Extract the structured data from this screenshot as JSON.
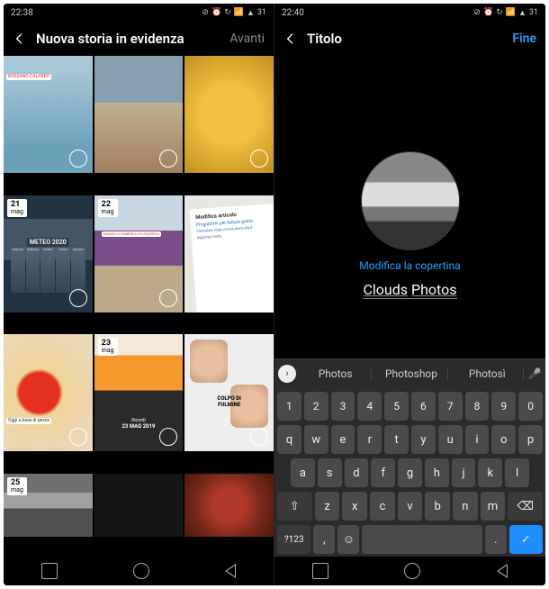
{
  "left": {
    "status": {
      "time": "22:38",
      "battery": "31"
    },
    "header": {
      "title": "Nuova storia in evidenza",
      "action": "Avanti"
    },
    "cells": [
      {
        "tag": "ROSSANO CALABRO"
      },
      {},
      {},
      {
        "date_d": "21",
        "date_m": "mag",
        "label": "METEO 2020"
      },
      {
        "date_d": "22",
        "date_m": "mag",
        "tag": "ARANELLI FABBRICA DI LIQUIRIZIA"
      },
      {
        "doc_t1": "Modifica articolo",
        "doc_t2": "Programmi per fatture gratis",
        "doc_t3": "Permalink: https://www.aranzulla.it",
        "doc_t4": "Aggiungi media"
      },
      {
        "tag": "Oggi a base di pesce"
      },
      {
        "date_d": "23",
        "date_m": "mag",
        "stamp_l1": "Ricordi",
        "stamp_l2": "23 MAG 2019"
      },
      {
        "label": "COLPO DI FULMINE"
      },
      {
        "date_d": "25",
        "date_m": "mag"
      },
      {},
      {}
    ]
  },
  "right": {
    "status": {
      "time": "22:40",
      "battery": "31"
    },
    "header": {
      "title": "Titolo",
      "done": "Fine"
    },
    "edit_cover": "Modifica la copertina",
    "input_w1": "Clouds",
    "input_w2": "Photos",
    "suggestions": [
      "Photos",
      "Photoshop",
      "Photosì"
    ],
    "kb": {
      "nums": [
        "1",
        "2",
        "3",
        "4",
        "5",
        "6",
        "7",
        "8",
        "9",
        "0"
      ],
      "r1": [
        "q",
        "w",
        "e",
        "r",
        "t",
        "y",
        "u",
        "i",
        "o",
        "p"
      ],
      "r2": [
        "a",
        "s",
        "d",
        "f",
        "g",
        "h",
        "j",
        "k",
        "l"
      ],
      "r3": [
        "z",
        "x",
        "c",
        "v",
        "b",
        "n",
        "m"
      ],
      "shift": "⇧",
      "back": "⌫",
      "sym": "?123",
      "comma": ",",
      "emoji": "☺",
      "dot": ".",
      "enter": "✓"
    }
  }
}
